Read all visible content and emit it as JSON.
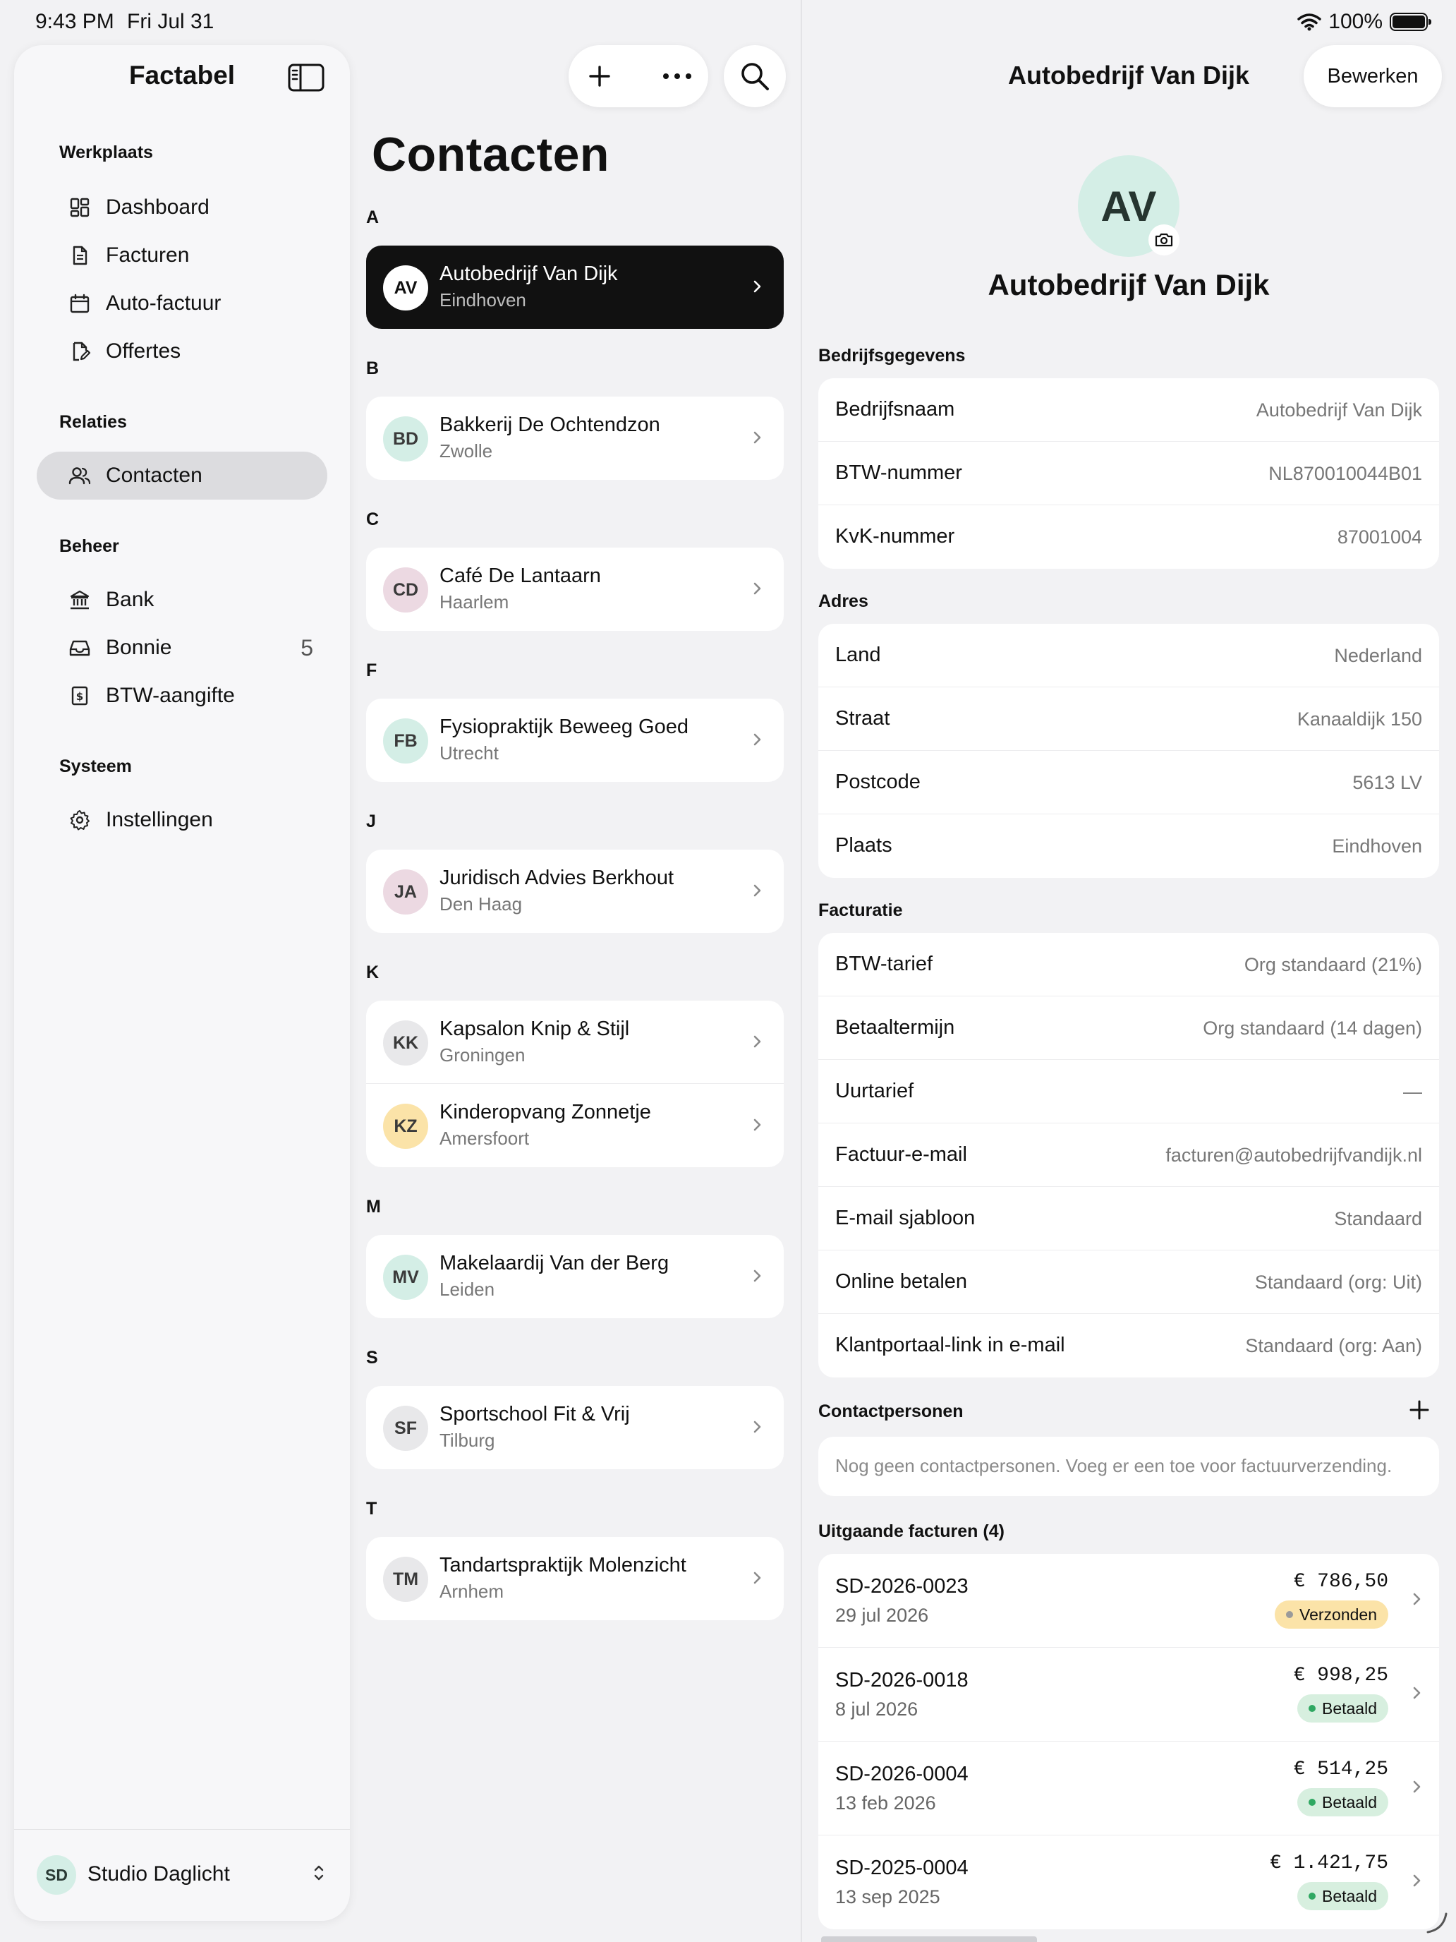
{
  "status_bar": {
    "time": "9:43 PM",
    "date": "Fri Jul 31",
    "battery": "100%"
  },
  "sidebar": {
    "title": "Factabel",
    "sections": [
      {
        "label": "Werkplaats",
        "items": [
          {
            "label": "Dashboard",
            "icon": "dashboard-icon"
          },
          {
            "label": "Facturen",
            "icon": "document-icon"
          },
          {
            "label": "Auto-factuur",
            "icon": "calendar-icon"
          },
          {
            "label": "Offertes",
            "icon": "edit-document-icon"
          }
        ]
      },
      {
        "label": "Relaties",
        "items": [
          {
            "label": "Contacten",
            "icon": "people-icon",
            "active": true
          }
        ]
      },
      {
        "label": "Beheer",
        "items": [
          {
            "label": "Bank",
            "icon": "bank-icon"
          },
          {
            "label": "Bonnie",
            "icon": "inbox-icon",
            "count": "5"
          },
          {
            "label": "BTW-aangifte",
            "icon": "tax-icon"
          }
        ]
      },
      {
        "label": "Systeem",
        "items": [
          {
            "label": "Instellingen",
            "icon": "gear-icon"
          }
        ]
      }
    ],
    "footer": {
      "initials": "SD",
      "name": "Studio Daglicht"
    }
  },
  "contacts": {
    "title": "Contacten",
    "groups": [
      {
        "letter": "A",
        "items": [
          {
            "initials": "AV",
            "name": "Autobedrijf Van Dijk",
            "city": "Eindhoven",
            "selected": true
          }
        ]
      },
      {
        "letter": "B",
        "items": [
          {
            "initials": "BD",
            "name": "Bakkerij De Ochtendzon",
            "city": "Zwolle",
            "color": "#d4eee6"
          }
        ]
      },
      {
        "letter": "C",
        "items": [
          {
            "initials": "CD",
            "name": "Café De Lantaarn",
            "city": "Haarlem",
            "color": "#ecd9e2"
          }
        ]
      },
      {
        "letter": "F",
        "items": [
          {
            "initials": "FB",
            "name": "Fysiopraktijk Beweeg Goed",
            "city": "Utrecht",
            "color": "#d4eee6"
          }
        ]
      },
      {
        "letter": "J",
        "items": [
          {
            "initials": "JA",
            "name": "Juridisch Advies Berkhout",
            "city": "Den Haag",
            "color": "#ecd9e2"
          }
        ]
      },
      {
        "letter": "K",
        "items": [
          {
            "initials": "KK",
            "name": "Kapsalon Knip & Stijl",
            "city": "Groningen",
            "color": "#e8e8ea"
          },
          {
            "initials": "KZ",
            "name": "Kinderopvang Zonnetje",
            "city": "Amersfoort",
            "color": "#fbe3a8"
          }
        ]
      },
      {
        "letter": "M",
        "items": [
          {
            "initials": "MV",
            "name": "Makelaardij Van der Berg",
            "city": "Leiden",
            "color": "#d4eee6"
          }
        ]
      },
      {
        "letter": "S",
        "items": [
          {
            "initials": "SF",
            "name": "Sportschool Fit & Vrij",
            "city": "Tilburg",
            "color": "#e8e8ea"
          }
        ]
      },
      {
        "letter": "T",
        "items": [
          {
            "initials": "TM",
            "name": "Tandartspraktijk Molenzicht",
            "city": "Arnhem",
            "color": "#e8e8ea"
          }
        ]
      }
    ]
  },
  "detail": {
    "header_title": "Autobedrijf Van Dijk",
    "edit_label": "Bewerken",
    "avatar_initials": "AV",
    "name": "Autobedrijf Van Dijk",
    "company": {
      "heading": "Bedrijfsgegevens",
      "rows": [
        {
          "k": "Bedrijfsnaam",
          "v": "Autobedrijf Van Dijk"
        },
        {
          "k": "BTW-nummer",
          "v": "NL870010044B01"
        },
        {
          "k": "KvK-nummer",
          "v": "87001004"
        }
      ]
    },
    "address": {
      "heading": "Adres",
      "rows": [
        {
          "k": "Land",
          "v": "Nederland"
        },
        {
          "k": "Straat",
          "v": "Kanaaldijk 150"
        },
        {
          "k": "Postcode",
          "v": "5613 LV"
        },
        {
          "k": "Plaats",
          "v": "Eindhoven"
        }
      ]
    },
    "billing": {
      "heading": "Facturatie",
      "rows": [
        {
          "k": "BTW-tarief",
          "v": "Org standaard (21%)"
        },
        {
          "k": "Betaaltermijn",
          "v": "Org standaard (14 dagen)"
        },
        {
          "k": "Uurtarief",
          "v": "—"
        },
        {
          "k": "Factuur-e-mail",
          "v": "facturen@autobedrijfvandijk.nl"
        },
        {
          "k": "E-mail sjabloon",
          "v": "Standaard"
        },
        {
          "k": "Online betalen",
          "v": "Standaard (org: Uit)"
        },
        {
          "k": "Klantportaal-link in e-mail",
          "v": "Standaard (org: Aan)"
        }
      ]
    },
    "contact_persons": {
      "heading": "Contactpersonen",
      "empty_text": "Nog geen contactpersonen. Voeg er een toe voor factuurverzending."
    },
    "invoices": {
      "heading": "Uitgaande facturen (4)",
      "items": [
        {
          "number": "SD-2026-0023",
          "date": "29 jul 2026",
          "amount": "€ 786,50",
          "status": "Verzonden",
          "status_bg": "#fbe3a8",
          "dot": "#9a9a9a"
        },
        {
          "number": "SD-2026-0018",
          "date": "8 jul 2026",
          "amount": "€ 998,25",
          "status": "Betaald",
          "status_bg": "#d7efdf",
          "dot": "#2fa862"
        },
        {
          "number": "SD-2026-0004",
          "date": "13 feb 2026",
          "amount": "€ 514,25",
          "status": "Betaald",
          "status_bg": "#d7efdf",
          "dot": "#2fa862"
        },
        {
          "number": "SD-2025-0004",
          "date": "13 sep 2025",
          "amount": "€ 1.421,75",
          "status": "Betaald",
          "status_bg": "#d7efdf",
          "dot": "#2fa862"
        }
      ]
    }
  }
}
